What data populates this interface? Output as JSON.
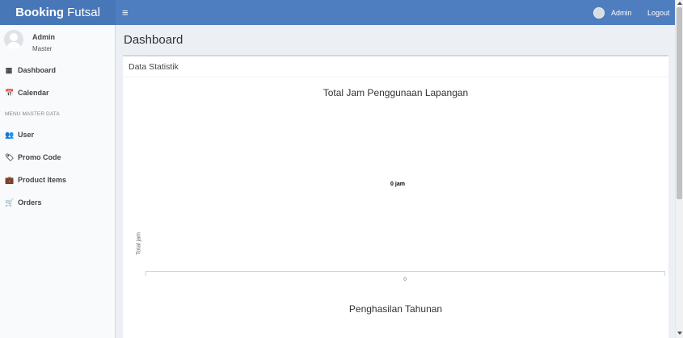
{
  "header": {
    "brand_bold": "Booking",
    "brand_light": "Futsal",
    "toggle_icon": "≡",
    "user_name": "Admin",
    "logout_label": "Logout",
    "color": "#4f7ec0"
  },
  "sidebar": {
    "user": {
      "name": "Admin",
      "role": "Master"
    },
    "items": [
      {
        "label": "Dashboard",
        "icon": "▦",
        "icon_name": "dashboard-icon"
      },
      {
        "label": "Calendar",
        "icon": "📅",
        "icon_name": "calendar-icon"
      }
    ],
    "section_header": "MENU MASTER DATA",
    "master_items": [
      {
        "label": "User",
        "icon": "👥",
        "icon_name": "users-icon"
      },
      {
        "label": "Promo Code",
        "icon": "🏷",
        "icon_name": "tag-icon"
      },
      {
        "label": "Product Items",
        "icon": "💼",
        "icon_name": "briefcase-icon"
      },
      {
        "label": "Orders",
        "icon": "🛒",
        "icon_name": "cart-icon"
      }
    ]
  },
  "main": {
    "page_title": "Dashboard",
    "box_title": "Data Statistik"
  },
  "chart_data": [
    {
      "type": "bar",
      "title": "Total Jam Penggunaan Lapangan",
      "ylabel": "Total jam",
      "xlabel": "",
      "categories": [
        "0"
      ],
      "values": [
        0
      ],
      "data_labels": [
        "0 jam"
      ]
    },
    {
      "type": "bar",
      "title": "Penghasilan Tahunan"
    }
  ]
}
